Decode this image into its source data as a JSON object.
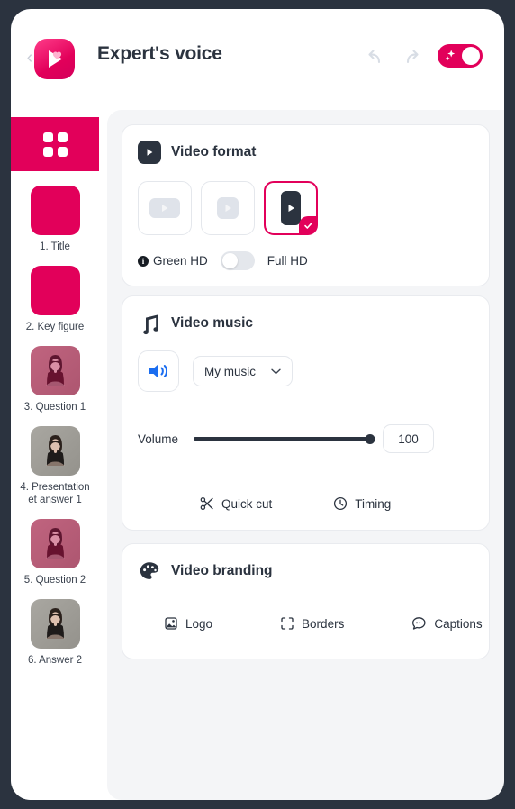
{
  "theme": {
    "accent_pink": "#e2005a",
    "dark_navy": "#2b333f",
    "panel_bg": "#f4f5f7",
    "blue_icon": "#1a6df0",
    "border": "#e4e7ec"
  },
  "header": {
    "title": "Expert's voice",
    "back_label": "‹",
    "logo_name": "video-app-logo",
    "undo_label": "undo",
    "redo_label": "redo",
    "ai_toggle_label": "AI magic",
    "ai_toggle_state": "on"
  },
  "sidebar": {
    "grid_button_label": "All scenes",
    "scenes": [
      {
        "label": "1. Title",
        "thumb": "pink-solid"
      },
      {
        "label": "2. Key figure",
        "thumb": "pink-solid"
      },
      {
        "label": "3. Question 1",
        "thumb": "pink-photo"
      },
      {
        "label": "4. Presentation et answer 1",
        "thumb": "gray-photo"
      },
      {
        "label": "5. Question 2",
        "thumb": "pink-photo"
      },
      {
        "label": "6. Answer 2",
        "thumb": "gray-photo"
      }
    ]
  },
  "cards": {
    "video_format": {
      "title": "Video format",
      "icon": "play-square-icon",
      "options": [
        {
          "name": "landscape-16-9",
          "selected": false
        },
        {
          "name": "square-1-1",
          "selected": false
        },
        {
          "name": "portrait-9-16",
          "selected": true
        }
      ],
      "quality_left_label": "Green HD",
      "quality_right_label": "Full HD",
      "quality_toggle_state": "off",
      "info_glyph": "i"
    },
    "video_music": {
      "title": "Video music",
      "icon": "music-note-icon",
      "speaker_button_label": "Preview sound",
      "music_select_value": "My music",
      "volume_label": "Volume",
      "volume_value": "100",
      "volume_percent": 100,
      "actions": [
        {
          "label": "Quick cut",
          "icon": "scissors-icon"
        },
        {
          "label": "Timing",
          "icon": "clock-icon"
        }
      ]
    },
    "video_branding": {
      "title": "Video branding",
      "icon": "palette-icon",
      "actions": [
        {
          "label": "Logo",
          "icon": "image-icon"
        },
        {
          "label": "Borders",
          "icon": "dashed-frame-icon"
        },
        {
          "label": "Captions",
          "icon": "speech-bubble-icon"
        }
      ]
    }
  }
}
